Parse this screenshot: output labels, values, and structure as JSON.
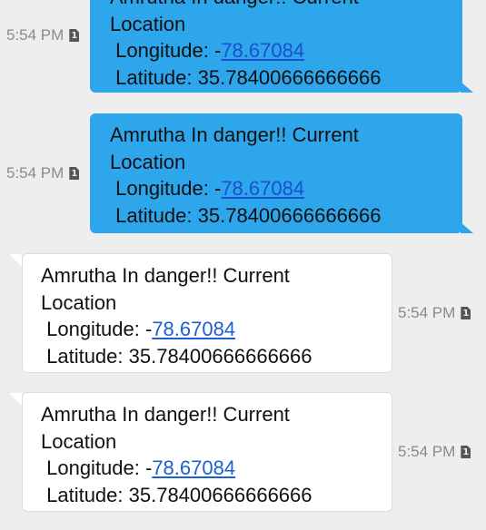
{
  "messages": [
    {
      "direction": "outgoing",
      "time": "5:54 PM",
      "sim_label": "1",
      "line1": "Amrutha In danger!! Current",
      "line2": "Location",
      "lon_prefix": " Longitude: -",
      "lon_link": "78.67084",
      "lat_line": " Latitude: 35.78400666666666"
    },
    {
      "direction": "outgoing",
      "time": "5:54 PM",
      "sim_label": "1",
      "line1": "Amrutha In danger!! Current",
      "line2": "Location",
      "lon_prefix": " Longitude: -",
      "lon_link": "78.67084",
      "lat_line": " Latitude: 35.78400666666666"
    },
    {
      "direction": "incoming",
      "time": "5:54 PM",
      "sim_label": "1",
      "line1": "Amrutha In danger!! Current",
      "line2": "Location",
      "lon_prefix": " Longitude: -",
      "lon_link": "78.67084",
      "lat_line": " Latitude: 35.78400666666666"
    },
    {
      "direction": "incoming",
      "time": "5:54 PM",
      "sim_label": "1",
      "line1": "Amrutha In danger!! Current",
      "line2": "Location",
      "lon_prefix": " Longitude: -",
      "lon_link": "78.67084",
      "lat_line": " Latitude: 35.78400666666666"
    }
  ],
  "colors": {
    "outgoing_bubble": "#2ea6ec",
    "incoming_bubble": "#ffffff",
    "background": "#eeeeee",
    "link": "#1c5fd0",
    "timestamp": "#8a8a8a"
  }
}
